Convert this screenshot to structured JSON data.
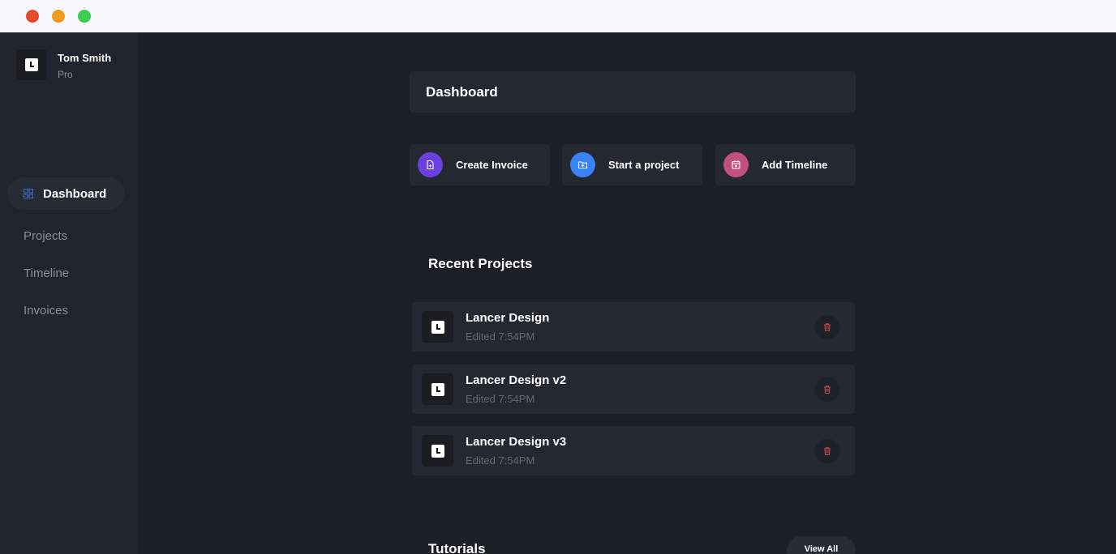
{
  "window": {
    "controls": [
      "close",
      "minimize",
      "maximize"
    ],
    "colors": {
      "close": "#e5482f",
      "minimize": "#f29a1b",
      "maximize": "#3ccc52"
    }
  },
  "user": {
    "name": "Tom Smith",
    "plan": "Pro"
  },
  "sidebar": {
    "items": [
      {
        "label": "Dashboard",
        "active": true
      },
      {
        "label": "Projects",
        "active": false
      },
      {
        "label": "Timeline",
        "active": false
      },
      {
        "label": "Invoices",
        "active": false
      }
    ]
  },
  "header": {
    "title": "Dashboard"
  },
  "quick_actions": [
    {
      "label": "Create Invoice",
      "icon": "file-plus-icon",
      "color": "#6b3fe0"
    },
    {
      "label": "Start a project",
      "icon": "folder-plus-icon",
      "color": "#3b82f6"
    },
    {
      "label": "Add Timeline",
      "icon": "calendar-plus-icon",
      "color": "#c0517f"
    }
  ],
  "recent_projects": {
    "title": "Recent Projects",
    "items": [
      {
        "name": "Lancer Design",
        "meta": "Edited 7:54PM"
      },
      {
        "name": "Lancer Design v2",
        "meta": "Edited 7:54PM"
      },
      {
        "name": "Lancer Design v3",
        "meta": "Edited 7:54PM"
      }
    ]
  },
  "tutorials": {
    "title": "Tutorials",
    "view_all_label": "View All"
  },
  "colors": {
    "delete": "#c44a4a",
    "accent": "#3b6fd8"
  }
}
